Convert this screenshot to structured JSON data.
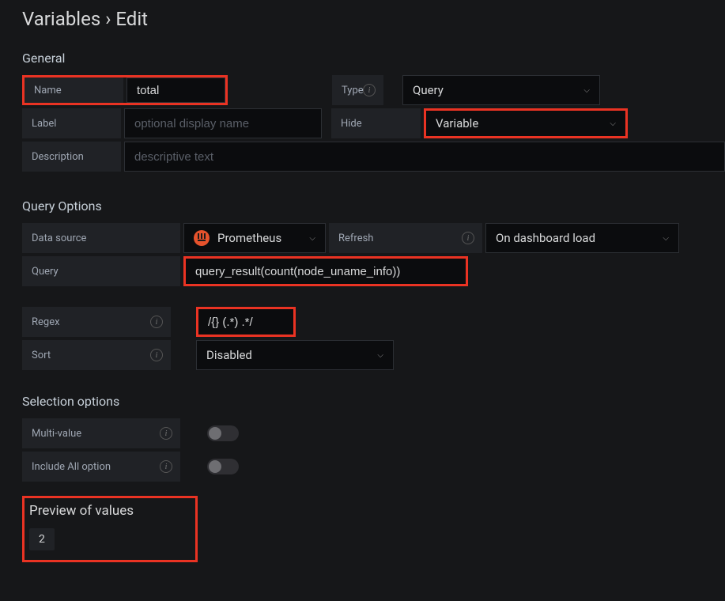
{
  "breadcrumb": "Variables › Edit",
  "sections": {
    "general": "General",
    "query_options": "Query Options",
    "selection_options": "Selection options"
  },
  "general": {
    "name_label": "Name",
    "name_value": "total",
    "type_label": "Type",
    "type_value": "Query",
    "label_label": "Label",
    "label_placeholder": "optional display name",
    "hide_label": "Hide",
    "hide_value": "Variable",
    "description_label": "Description",
    "description_placeholder": "descriptive text"
  },
  "query_options": {
    "ds_label": "Data source",
    "ds_value": "Prometheus",
    "refresh_label": "Refresh",
    "refresh_value": "On dashboard load",
    "query_label": "Query",
    "query_value": "query_result(count(node_uname_info))",
    "regex_label": "Regex",
    "regex_value": "/{} (.*) .*/",
    "sort_label": "Sort",
    "sort_value": "Disabled"
  },
  "selection_options": {
    "multi_label": "Multi-value",
    "include_all_label": "Include All option"
  },
  "preview": {
    "title": "Preview of values",
    "values": [
      "2"
    ]
  }
}
